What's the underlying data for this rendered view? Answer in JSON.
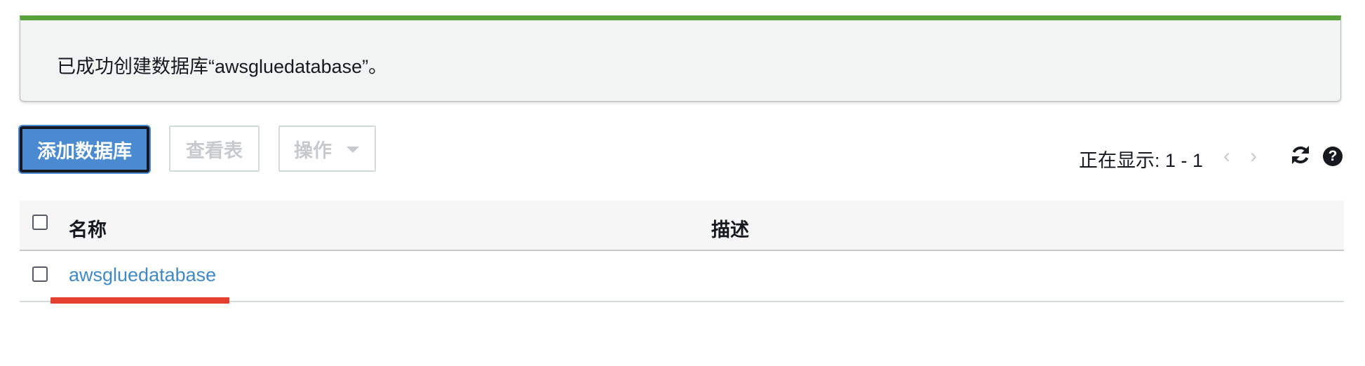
{
  "flash": {
    "message": "已成功创建数据库“awsgluedatabase”。",
    "accent_color": "#5aa03c"
  },
  "toolbar": {
    "add_database_label": "添加数据库",
    "view_tables_label": "查看表",
    "actions_label": "操作",
    "actions_icon": "chevron-down-icon"
  },
  "pagination": {
    "showing_text": "正在显示: 1 - 1",
    "prev_icon": "chevron-left-icon",
    "next_icon": "chevron-right-icon",
    "prev_glyph": "‹",
    "next_glyph": "›"
  },
  "icons": {
    "refresh": "refresh-icon",
    "help": "help-icon",
    "help_glyph": "?"
  },
  "table": {
    "columns": [
      "名称",
      "描述"
    ],
    "rows": [
      {
        "name": "awsgluedatabase",
        "description": ""
      }
    ]
  },
  "colors": {
    "primary_button": "#4a8ad0",
    "link": "#3f89c9",
    "annotation_underline": "#e43f2f"
  }
}
